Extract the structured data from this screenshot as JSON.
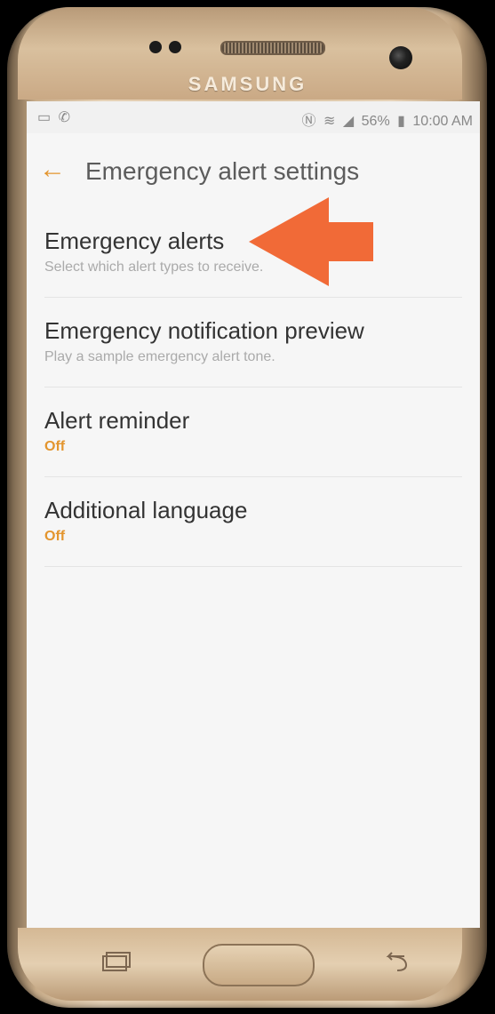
{
  "device": {
    "brand": "SAMSUNG"
  },
  "status_bar": {
    "left_icons": [
      "screenshot-icon",
      "call-icon"
    ],
    "right_icons": [
      "nfc-icon",
      "wifi-icon",
      "signal-icon"
    ],
    "battery": "56%",
    "time": "10:00 AM"
  },
  "header": {
    "title": "Emergency alert settings"
  },
  "items": [
    {
      "title": "Emergency alerts",
      "subtitle": "Select which alert types to receive."
    },
    {
      "title": "Emergency notification preview",
      "subtitle": "Play a sample emergency alert tone."
    },
    {
      "title": "Alert reminder",
      "subtitle": "Off"
    },
    {
      "title": "Additional language",
      "subtitle": "Off"
    }
  ],
  "colors": {
    "accent": "#e3952e",
    "arrow": "#f0622c",
    "title_text": "#333333"
  }
}
